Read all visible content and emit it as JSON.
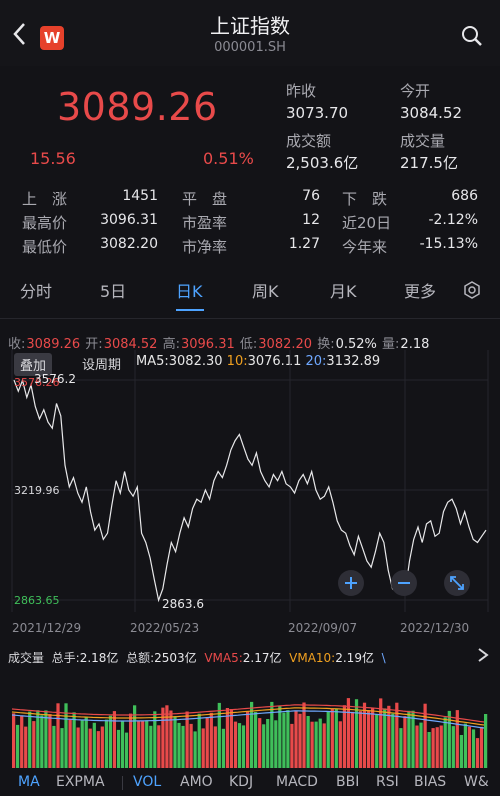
{
  "header": {
    "back_icon": "chevron-left-icon",
    "logo_text": "W",
    "title": "上证指数",
    "code": "000001.SH",
    "search_icon": "search-icon"
  },
  "quote": {
    "price": "3089.26",
    "change": "15.56",
    "change_pct": "0.51%",
    "prev_close_label": "昨收",
    "prev_close": "3073.70",
    "open_label": "今开",
    "open": "3084.52",
    "turnover_label": "成交额",
    "turnover": "2,503.6亿",
    "volume_label": "成交量",
    "volume": "217.5亿"
  },
  "stats": {
    "up_label": "上　涨",
    "up": "1451",
    "flat_label": "平　盘",
    "flat": "76",
    "down_label": "下　跌",
    "down": "686",
    "high_label": "最高价",
    "high": "3096.31",
    "pe_label": "市盈率",
    "pe": "12",
    "d20_label": "近20日",
    "d20": "-2.12%",
    "low_label": "最低价",
    "low": "3082.20",
    "pb_label": "市净率",
    "pb": "1.27",
    "ytd_label": "今年来",
    "ytd": "-15.13%"
  },
  "tabs": [
    "分时",
    "5日",
    "日K",
    "周K",
    "月K",
    "更多"
  ],
  "active_tab": "日K",
  "settings_icon": "settings-icon",
  "infoline": {
    "close_label": "收:",
    "close": "3089.26",
    "open_label": "开:",
    "open": "3084.52",
    "high_label": "高:",
    "high": "3096.31",
    "low_label": "低:",
    "low": "3082.20",
    "turn_label": "换:",
    "turn": "0.52%",
    "vol_label": "量:",
    "vol": "2.18"
  },
  "chart_controls": {
    "overlay": "叠加",
    "set_period": "设周期",
    "ma5_label": "MA5:",
    "ma5": "3082.30",
    "ma10_label": "10:",
    "ma10": "3076.11",
    "ma20_label": "20:",
    "ma20": "3132.89"
  },
  "chart_data": {
    "type": "line",
    "x": [
      "2021/12/29",
      "2022/05/23",
      "2022/09/07",
      "2022/12/30"
    ],
    "y_ticks": [
      "3576.26",
      "3219.96",
      "2863.65"
    ],
    "annotations": [
      "3576.2",
      "2863.6"
    ],
    "series": [
      {
        "values": [
          3576,
          3540,
          3575,
          3520,
          3560,
          3490,
          3450,
          3480,
          3440,
          3420,
          3500,
          3460,
          3300,
          3230,
          3260,
          3210,
          3180,
          3230,
          3150,
          3090,
          3110,
          3060,
          3080,
          3170,
          3250,
          3210,
          3280,
          3220,
          3200,
          3230,
          3080,
          3050,
          3000,
          2930,
          2863,
          2900,
          2980,
          3050,
          3020,
          3080,
          3130,
          3100,
          3160,
          3190,
          3180,
          3220,
          3190,
          3250,
          3280,
          3260,
          3300,
          3350,
          3380,
          3400,
          3360,
          3320,
          3300,
          3340,
          3280,
          3250,
          3230,
          3270,
          3250,
          3280,
          3240,
          3230,
          3210,
          3250,
          3270,
          3240,
          3280,
          3220,
          3190,
          3200,
          3230,
          3180,
          3120,
          3090,
          3080,
          3040,
          3010,
          3070,
          3030,
          2990,
          2970,
          3020,
          3080,
          3050,
          2960,
          2900,
          2890,
          2930,
          2890,
          2990,
          3060,
          3100,
          3050,
          3110,
          3120,
          3070,
          3080,
          3150,
          3180,
          3190,
          3160,
          3110,
          3150,
          3100,
          3060,
          3050,
          3070,
          3090
        ]
      }
    ]
  },
  "zoom": {
    "zoom_in_icon": "zoom-in-icon",
    "zoom_out_icon": "zoom-out-icon",
    "fullscreen_icon": "expand-icon"
  },
  "volume": {
    "label": "成交量",
    "total_hands_label": "总手:",
    "total_hands": "2.18亿",
    "total_amount_label": "总额:",
    "total_amount": "2503亿",
    "vma5_label": "VMA5:",
    "vma5": "2.17亿",
    "vma10_label": "VMA10:",
    "vma10": "2.19亿",
    "vma20_partial": "\\"
  },
  "bottom_tabs": [
    "MA",
    "EXPMA",
    "VOL",
    "AMO",
    "KDJ",
    "MACD",
    "BBI",
    "RSI",
    "BIAS",
    "W&"
  ],
  "colors": {
    "up": "#e84a4a",
    "down": "#3fbf5a",
    "accent": "#4ea3ff",
    "ma5": "#e6e6e6",
    "ma10": "#f0a020",
    "ma20": "#6fa8ff"
  }
}
